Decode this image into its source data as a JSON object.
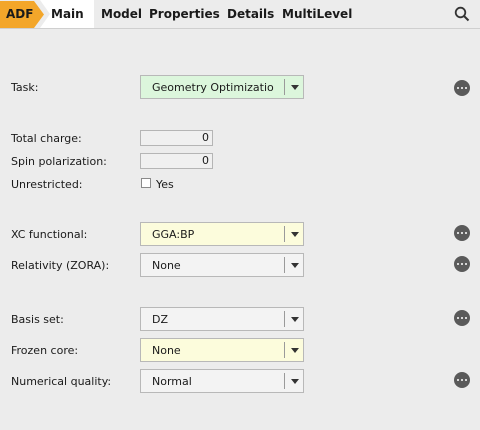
{
  "tabs": {
    "adf": "ADF",
    "main": "Main",
    "menu": [
      "Model",
      "Properties",
      "Details",
      "MultiLevel"
    ]
  },
  "form": {
    "task": {
      "label": "Task:",
      "value": "Geometry Optimizatio"
    },
    "total_charge": {
      "label": "Total charge:",
      "value": "0"
    },
    "spin_polarization": {
      "label": "Spin polarization:",
      "value": "0"
    },
    "unrestricted": {
      "label": "Unrestricted:",
      "checkbox_label": "Yes",
      "checked": false
    },
    "xc_functional": {
      "label": "XC functional:",
      "value": "GGA:BP"
    },
    "relativity": {
      "label": "Relativity (ZORA):",
      "value": "None"
    },
    "basis_set": {
      "label": "Basis set:",
      "value": "DZ"
    },
    "frozen_core": {
      "label": "Frozen core:",
      "value": "None"
    },
    "numerical_quality": {
      "label": "Numerical quality:",
      "value": "Normal"
    }
  },
  "colors": {
    "adf_accent": "#f3a62a",
    "task_highlight": "#dcf6dc",
    "modified_highlight": "#fcfcdc"
  },
  "icons": [
    "search-icon",
    "more-options-icon",
    "dropdown-arrow-icon"
  ]
}
